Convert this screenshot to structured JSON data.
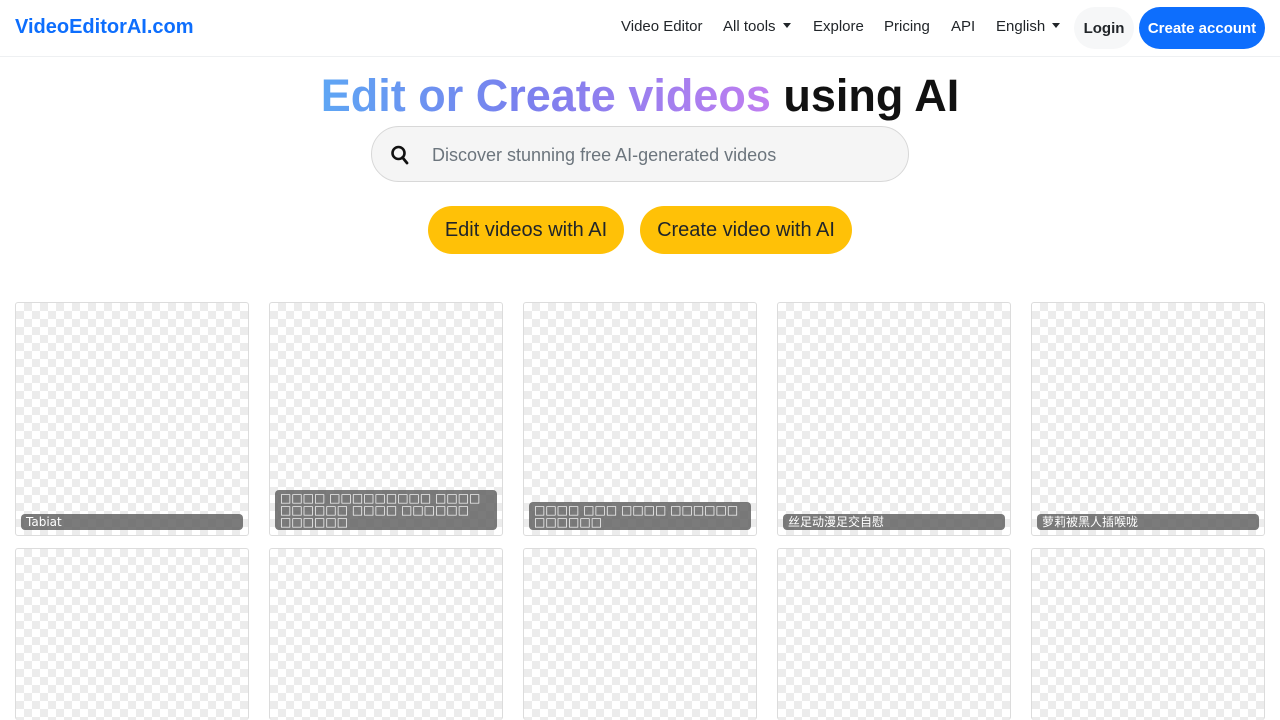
{
  "nav": {
    "brand": "VideoEditorAI.com",
    "links": [
      "Video Editor",
      "All tools",
      "Explore",
      "Pricing",
      "API",
      "English"
    ],
    "login": "Login",
    "create_account": "Create account"
  },
  "hero": {
    "title_part1": "Edit or Create videos",
    "title_part2": "using AI"
  },
  "search": {
    "placeholder": "Discover stunning free AI-generated videos",
    "icon": "search-icon"
  },
  "actions": {
    "edit": "Edit videos with AI",
    "create": "Create video with AI"
  },
  "gallery": {
    "captions": [
      "Tabiat",
      "□□□□ □□□□□□□□□ □□□□ □□□□□□ □□□□ □□□□□□ □□□□□□",
      "□□□□ □□□ □□□□ □□□□□□ □□□□□□",
      "丝足动漫足交自慰",
      "萝莉被黑人插喉咙"
    ]
  },
  "colors": {
    "brand": "#0d6efd",
    "button_yellow": "#ffc107",
    "gradient": [
      "#5ea6f4",
      "#7a80ee",
      "#c07ef0"
    ]
  }
}
